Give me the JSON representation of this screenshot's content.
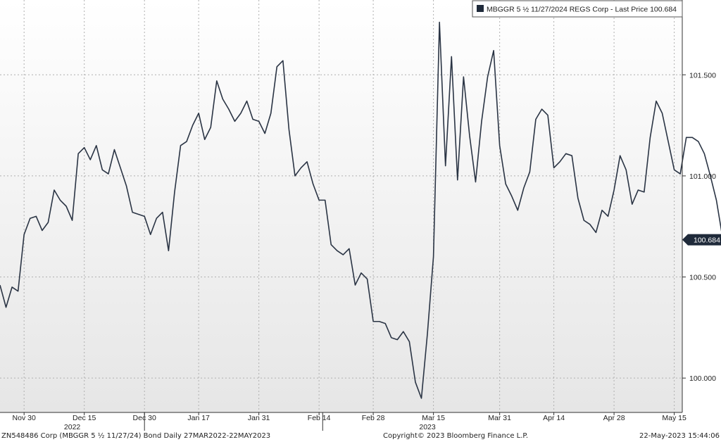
{
  "chart_data": {
    "type": "line",
    "legend_text": "MBGGR 5 ½  11/27/2024 REGS Corp - Last Price 100.684",
    "legend_placement": "top-right",
    "last_price_label": "100.684",
    "ylim": [
      99.83,
      101.87
    ],
    "y_ticks": [
      {
        "value": 100.0,
        "label": "100.000"
      },
      {
        "value": 100.5,
        "label": "100.500"
      },
      {
        "value": 101.0,
        "label": "101.000"
      },
      {
        "value": 101.5,
        "label": "101.500"
      }
    ],
    "x_ticks": [
      {
        "index": 4,
        "label": "Nov 30"
      },
      {
        "index": 14,
        "label": "Dec 15"
      },
      {
        "index": 24,
        "label": "Dec 30"
      },
      {
        "index": 33,
        "label": "Jan 17"
      },
      {
        "index": 43,
        "label": "Jan 31"
      },
      {
        "index": 53,
        "label": "Feb 14"
      },
      {
        "index": 62,
        "label": "Feb 28"
      },
      {
        "index": 72,
        "label": "Mar 15"
      },
      {
        "index": 83,
        "label": "Mar 31"
      },
      {
        "index": 92,
        "label": "Apr 14"
      },
      {
        "index": 102,
        "label": "Apr 28"
      },
      {
        "index": 112,
        "label": "May 15"
      }
    ],
    "year_labels": [
      {
        "index": 12,
        "label": "2022"
      },
      {
        "index": 71,
        "label": "2023"
      }
    ],
    "year_separators": [
      24,
      53.6
    ],
    "grid": true,
    "series": [
      {
        "color": "#2a3444",
        "values": [
          100.46,
          100.35,
          100.45,
          100.43,
          100.71,
          100.79,
          100.8,
          100.73,
          100.77,
          100.93,
          100.88,
          100.85,
          100.78,
          101.11,
          101.14,
          101.08,
          101.15,
          101.03,
          101.01,
          101.13,
          101.04,
          100.95,
          100.82,
          100.81,
          100.8,
          100.71,
          100.79,
          100.82,
          100.63,
          100.92,
          101.15,
          101.17,
          101.25,
          101.31,
          101.18,
          101.24,
          101.47,
          101.38,
          101.33,
          101.27,
          101.31,
          101.37,
          101.28,
          101.27,
          101.21,
          101.31,
          101.54,
          101.57,
          101.23,
          101.0,
          101.04,
          101.07,
          100.96,
          100.88,
          100.88,
          100.66,
          100.63,
          100.61,
          100.64,
          100.46,
          100.52,
          100.49,
          100.28,
          100.28,
          100.27,
          100.2,
          100.19,
          100.23,
          100.18,
          99.98,
          99.9,
          100.22,
          100.6,
          101.76,
          101.05,
          101.59,
          100.98,
          101.49,
          101.2,
          100.97,
          101.27,
          101.49,
          101.62,
          101.15,
          100.96,
          100.9,
          100.83,
          100.94,
          101.02,
          101.28,
          101.33,
          101.3,
          101.04,
          101.07,
          101.11,
          101.1,
          100.89,
          100.78,
          100.76,
          100.72,
          100.83,
          100.8,
          100.93,
          101.1,
          101.03,
          100.86,
          100.93,
          100.92,
          101.19,
          101.37,
          101.31,
          101.17,
          101.03,
          101.01,
          101.19,
          101.19,
          101.17,
          101.11,
          101.0,
          100.88,
          100.7,
          100.684
        ]
      }
    ]
  },
  "footer": {
    "left": "ZN548486 Corp (MBGGR 5 ½ 11/27/24) Bond  Daily 27MAR2022-22MAY2023",
    "center": "Copyright© 2023 Bloomberg Finance L.P.",
    "right": "22-May-2023 15:44:06"
  }
}
